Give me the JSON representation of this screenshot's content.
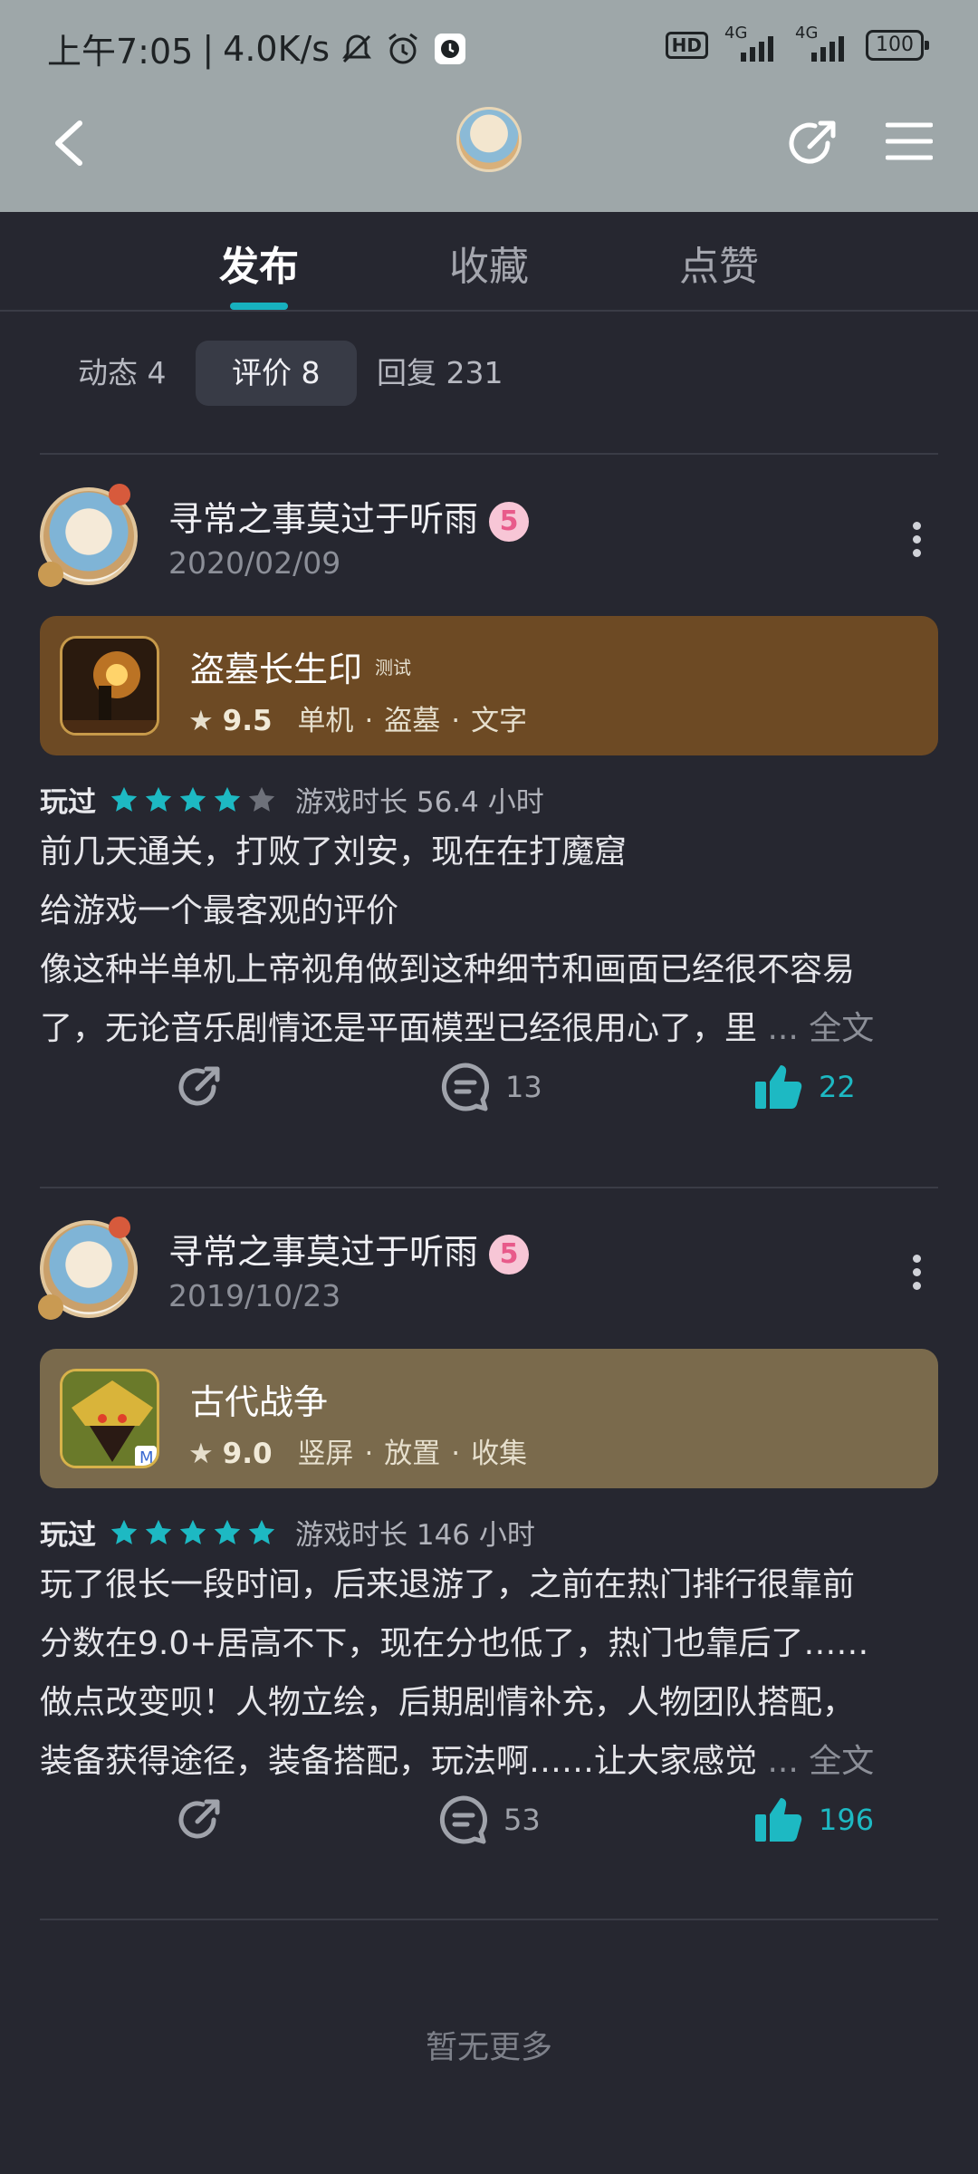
{
  "status_bar": {
    "time": "上午7:05",
    "net_speed": "4.0K/s",
    "hd_badge": "HD",
    "signal1_label": "4G",
    "signal2_label": "4G",
    "battery": "100"
  },
  "tabs": [
    {
      "label": "发布",
      "active": true
    },
    {
      "label": "收藏",
      "active": false
    },
    {
      "label": "点赞",
      "active": false
    }
  ],
  "subtabs": [
    {
      "label": "动态 4",
      "active": false
    },
    {
      "label": "评价 8",
      "active": true
    },
    {
      "label": "回复 231",
      "active": false
    }
  ],
  "reviews": [
    {
      "username": "寻常之事莫过于听雨",
      "level": "5",
      "date": "2020/02/09",
      "game": {
        "name": "盗墓长生印",
        "tag": "测试",
        "score": "9.5",
        "genres": [
          "单机",
          "盗墓",
          "文字"
        ],
        "bg": "#6d4a24"
      },
      "played_label": "玩过",
      "rating": 4,
      "playtime": "游戏时长 56.4 小时",
      "lines": [
        "前几天通关，打败了刘安，现在在打魔窟",
        "给游戏一个最客观的评价",
        "像这种半单机上帝视角做到这种细节和画面已经很不容易",
        "了，无论音乐剧情还是平面模型已经很用心了，里"
      ],
      "more_label": "... 全文",
      "comments": "13",
      "likes": "22"
    },
    {
      "username": "寻常之事莫过于听雨",
      "level": "5",
      "date": "2019/10/23",
      "game": {
        "name": "古代战争",
        "tag": "",
        "score": "9.0",
        "genres": [
          "竖屏",
          "放置",
          "收集"
        ],
        "bg": "#7a6a4c"
      },
      "played_label": "玩过",
      "rating": 5,
      "playtime": "游戏时长 146 小时",
      "lines": [
        "玩了很长一段时间，后来退游了，之前在热门排行很靠前",
        "分数在9.0+居高不下，现在分也低了，热门也靠后了……",
        "做点改变呗！人物立绘，后期剧情补充，人物团队搭配，",
        "装备获得途径，装备搭配，玩法啊……让大家感觉"
      ],
      "more_label": "... 全文",
      "comments": "53",
      "likes": "196"
    }
  ],
  "footer": "暂无更多",
  "colors": {
    "accent": "#17b1be",
    "liked": "#1db9c3",
    "header_bg": "#9ea7a9",
    "page_bg": "#262730"
  }
}
